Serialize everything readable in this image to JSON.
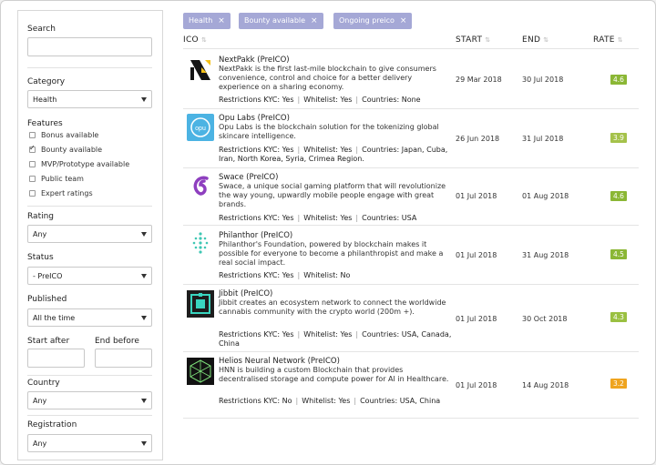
{
  "sidebar": {
    "search_label": "Search",
    "category_label": "Category",
    "category_value": "Health",
    "features_label": "Features",
    "features": [
      {
        "label": "Bonus available",
        "checked": false
      },
      {
        "label": "Bounty available",
        "checked": true
      },
      {
        "label": "MVP/Prototype available",
        "checked": false
      },
      {
        "label": "Public team",
        "checked": false
      },
      {
        "label": "Expert ratings",
        "checked": false
      }
    ],
    "rating_label": "Rating",
    "rating_value": "Any",
    "status_label": "Status",
    "status_value": "- PreICO",
    "published_label": "Published",
    "published_value": "All the time",
    "start_after_label": "Start after",
    "end_before_label": "End before",
    "country_label": "Country",
    "country_value": "Any",
    "registration_label": "Registration",
    "registration_value": "Any"
  },
  "filters": [
    {
      "label": "Health",
      "close": "×"
    },
    {
      "label": "Bounty available",
      "close": "×"
    },
    {
      "label": "Ongoing preico",
      "close": "×"
    }
  ],
  "table": {
    "headers": {
      "ico": "ICO",
      "start": "START",
      "end": "END",
      "rate": "RATE",
      "sort": "⇅"
    },
    "labels": {
      "restrictions": "Restrictions KYC:",
      "whitelist": "Whitelist:",
      "countries": "Countries:"
    },
    "rows": [
      {
        "name": "NextPakk (PreICO)",
        "desc": "NextPakk is the first last-mile blockchain to give consumers convenience, control and choice for a better delivery experience on a sharing economy.",
        "kyc": "Yes",
        "whitelist": "Yes",
        "countries": "None",
        "start": "29 Mar 2018",
        "end": "30 Jul 2018",
        "rate": "4.6",
        "rate_color": "#8bb735"
      },
      {
        "name": "Opu Labs (PreICO)",
        "desc": "Opu Labs is the blockchain solution for the tokenizing global skincare intelligence.",
        "kyc": "Yes",
        "whitelist": "Yes",
        "countries": "Japan, Cuba, Iran, North Korea, Syria, Crimea Region.",
        "start": "26 Jun 2018",
        "end": "31 Jul 2018",
        "rate": "3.9",
        "rate_color": "#a5c24b"
      },
      {
        "name": "Swace (PreICO)",
        "desc": "Swace, a unique social gaming platform that will revolutionize the way young, upwardly mobile people engage with great brands.",
        "kyc": "Yes",
        "whitelist": "Yes",
        "countries": "USA",
        "start": "01 Jul 2018",
        "end": "01 Aug 2018",
        "rate": "4.6",
        "rate_color": "#8bb735"
      },
      {
        "name": "Philanthor (PreICO)",
        "desc": "Philanthor's Foundation, powered by blockchain makes it possible for everyone to become a philanthropist and make a real social impact.",
        "kyc": "Yes",
        "whitelist": "No",
        "countries": "",
        "start": "01 Jul 2018",
        "end": "31 Aug 2018",
        "rate": "4.5",
        "rate_color": "#8bb735"
      },
      {
        "name": "Jibbit (PreICO)",
        "desc": "Jibbit creates an ecosystem network to connect the worldwide cannabis community with the crypto world (200m +).",
        "kyc": "Yes",
        "whitelist": "Yes",
        "countries": "USA, Canada, China",
        "start": "01 Jul 2018",
        "end": "30 Oct 2018",
        "rate": "4.3",
        "rate_color": "#9ac041"
      },
      {
        "name": "Helios Neural Network (PreICO)",
        "desc": "HNN is building a custom Blockchain that provides decentralised storage and compute power for AI in Healthcare.",
        "kyc": "No",
        "whitelist": "Yes",
        "countries": "USA, China",
        "start": "01 Jul 2018",
        "end": "14 Aug 2018",
        "rate": "3.2",
        "rate_color": "#efa41f"
      }
    ]
  }
}
